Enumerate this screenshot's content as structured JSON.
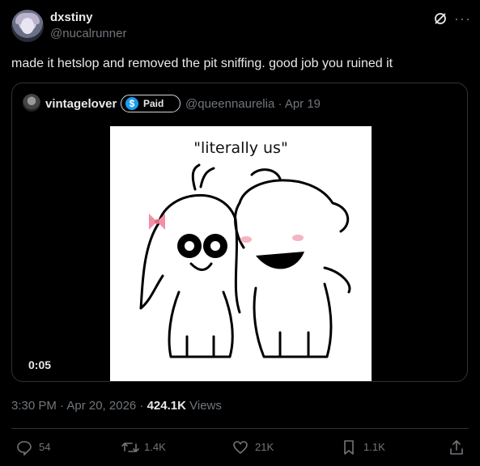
{
  "post": {
    "display_name": "dxstiny",
    "handle": "@nucalrunner",
    "text": "made it hetslop and removed the pit sniffing. good job you ruined it",
    "timestamp": "3:30 PM · Apr 20, 2026 · ",
    "views_count": "424.1K",
    "views_label": " Views"
  },
  "quote": {
    "display_name": "vintagelover",
    "badge_label": "Paid",
    "meta": "@queennaurelia · Apr 19",
    "video_caption": "\"literally us\"",
    "video_time": "0:05"
  },
  "actions": {
    "replies": "54",
    "reposts": "1.4K",
    "likes": "21K",
    "bookmarks": "1.1K"
  },
  "icons": {
    "grok": "grok-icon",
    "more": "more-icon",
    "reply": "reply-icon",
    "repost": "repost-icon",
    "like": "heart-icon",
    "bookmark": "bookmark-icon",
    "share": "share-icon"
  },
  "colors": {
    "background": "#000000",
    "text": "#e7e9ea",
    "muted": "#71767b",
    "border": "#2f3336",
    "accent": "#1d9bf0"
  }
}
